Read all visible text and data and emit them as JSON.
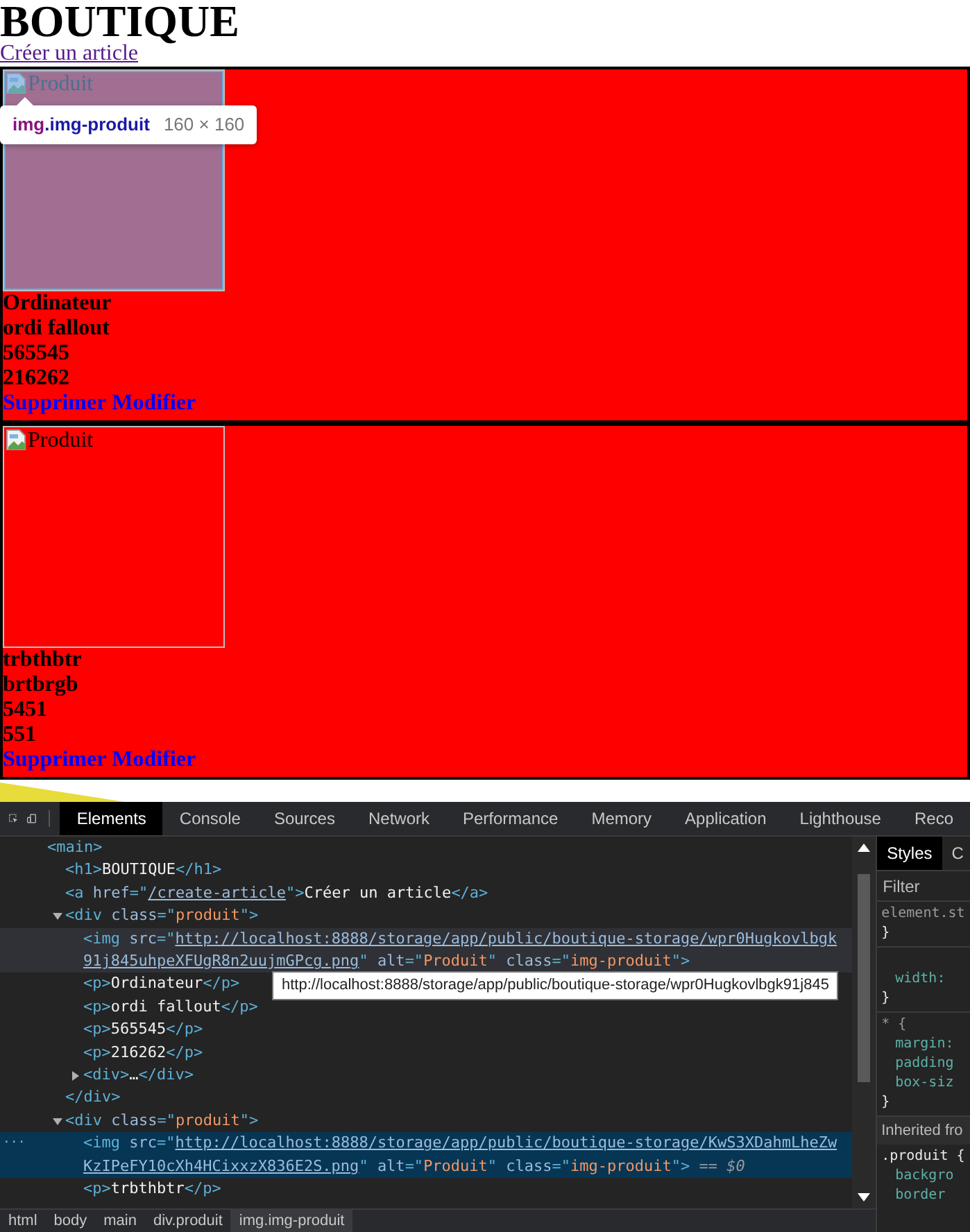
{
  "page": {
    "heading": "BOUTIQUE",
    "link": "Créer un article",
    "products": [
      {
        "image_alt": "Produit",
        "inspected": true,
        "details": [
          "Ordinateur",
          "ordi fallout",
          "565545",
          "216262"
        ],
        "actions": [
          "Supprimer",
          "Modifier"
        ]
      },
      {
        "image_alt": "Produit",
        "inspected": false,
        "details": [
          "trbthbtr",
          "brtbrgb",
          "5451",
          "551"
        ],
        "actions": [
          "Supprimer",
          "Modifier"
        ]
      }
    ]
  },
  "inspect_tooltip": {
    "tag": "img",
    "class": ".img-produit",
    "size": "160 × 160"
  },
  "devtools": {
    "tabs": [
      {
        "label": "Elements",
        "selected": true
      },
      {
        "label": "Console",
        "selected": false
      },
      {
        "label": "Sources",
        "selected": false
      },
      {
        "label": "Network",
        "selected": false
      },
      {
        "label": "Performance",
        "selected": false
      },
      {
        "label": "Memory",
        "selected": false
      },
      {
        "label": "Application",
        "selected": false
      },
      {
        "label": "Lighthouse",
        "selected": false
      },
      {
        "label": "Reco",
        "selected": false
      }
    ],
    "tree": [
      {
        "parts": [
          {
            "kind": "tag",
            "text": "<main>"
          }
        ],
        "children": [
          {
            "parts": [
              {
                "kind": "tag",
                "text": "<h1>"
              },
              {
                "kind": "text",
                "text": "BOUTIQUE"
              },
              {
                "kind": "tag",
                "text": "</h1>"
              }
            ]
          },
          {
            "parts": [
              {
                "kind": "tag",
                "text": "<a "
              },
              {
                "kind": "attr",
                "text": "href"
              },
              {
                "kind": "tag",
                "text": "=\""
              },
              {
                "kind": "link",
                "text": "/create-article"
              },
              {
                "kind": "tag",
                "text": "\">"
              },
              {
                "kind": "text",
                "text": "Créer un article"
              },
              {
                "kind": "tag",
                "text": "</a>"
              }
            ]
          },
          {
            "parts": [
              {
                "kind": "tag",
                "text": "<div "
              },
              {
                "kind": "attr",
                "text": "class"
              },
              {
                "kind": "tag",
                "text": "=\""
              },
              {
                "kind": "value",
                "text": "produit"
              },
              {
                "kind": "tag",
                "text": "\">"
              }
            ],
            "expanded": true,
            "closing": "</div>",
            "children": [
              {
                "hovered": true,
                "selected": false,
                "parts": [
                  {
                    "kind": "tag",
                    "text": "<img "
                  },
                  {
                    "kind": "attr",
                    "text": "src"
                  },
                  {
                    "kind": "tag",
                    "text": "=\""
                  },
                  {
                    "kind": "link",
                    "text": "http://localhost:8888/storage/app/public/boutique-storage/wpr0Hugkovlbgk91j845uhpeXFUgR8n2uujmGPcg.png"
                  },
                  {
                    "kind": "tag",
                    "text": "\" "
                  },
                  {
                    "kind": "attr",
                    "text": "alt"
                  },
                  {
                    "kind": "tag",
                    "text": "=\""
                  },
                  {
                    "kind": "value",
                    "text": "Produit"
                  },
                  {
                    "kind": "tag",
                    "text": "\" "
                  },
                  {
                    "kind": "attr",
                    "text": "class"
                  },
                  {
                    "kind": "tag",
                    "text": "=\""
                  },
                  {
                    "kind": "value",
                    "text": "img-produit"
                  },
                  {
                    "kind": "tag",
                    "text": "\">"
                  }
                ]
              },
              {
                "parts": [
                  {
                    "kind": "tag",
                    "text": "<p>"
                  },
                  {
                    "kind": "text",
                    "text": "Ordinateur"
                  },
                  {
                    "kind": "tag",
                    "text": "</p>"
                  }
                ]
              },
              {
                "parts": [
                  {
                    "kind": "tag",
                    "text": "<p>"
                  },
                  {
                    "kind": "text",
                    "text": "ordi fallout"
                  },
                  {
                    "kind": "tag",
                    "text": "</p>"
                  }
                ]
              },
              {
                "parts": [
                  {
                    "kind": "tag",
                    "text": "<p>"
                  },
                  {
                    "kind": "text",
                    "text": "565545"
                  },
                  {
                    "kind": "tag",
                    "text": "</p>"
                  }
                ]
              },
              {
                "parts": [
                  {
                    "kind": "tag",
                    "text": "<p>"
                  },
                  {
                    "kind": "text",
                    "text": "216262"
                  },
                  {
                    "kind": "tag",
                    "text": "</p>"
                  }
                ]
              },
              {
                "parts": [
                  {
                    "kind": "tag",
                    "text": "<div>"
                  },
                  {
                    "kind": "text",
                    "text": "…"
                  },
                  {
                    "kind": "tag",
                    "text": "</div>"
                  }
                ],
                "expanded": false
              }
            ]
          },
          {
            "parts": [
              {
                "kind": "tag",
                "text": "<div "
              },
              {
                "kind": "attr",
                "text": "class"
              },
              {
                "kind": "tag",
                "text": "=\""
              },
              {
                "kind": "value",
                "text": "produit"
              },
              {
                "kind": "tag",
                "text": "\">"
              }
            ],
            "expanded": true,
            "children": [
              {
                "hovered": false,
                "selected": true,
                "gutter": "···",
                "parts": [
                  {
                    "kind": "tag",
                    "text": "<img "
                  },
                  {
                    "kind": "attr",
                    "text": "src"
                  },
                  {
                    "kind": "tag",
                    "text": "=\""
                  },
                  {
                    "kind": "link",
                    "text": "http://localhost:8888/storage/app/public/boutique-storage/KwS3XDahmLheZwKzIPeFY10cXh4HCixxzX836E2S.png"
                  },
                  {
                    "kind": "tag",
                    "text": "\" "
                  },
                  {
                    "kind": "attr",
                    "text": "alt"
                  },
                  {
                    "kind": "tag",
                    "text": "=\""
                  },
                  {
                    "kind": "value",
                    "text": "Produit"
                  },
                  {
                    "kind": "tag",
                    "text": "\" "
                  },
                  {
                    "kind": "attr",
                    "text": "class"
                  },
                  {
                    "kind": "tag",
                    "text": "=\""
                  },
                  {
                    "kind": "value",
                    "text": "img-produit"
                  },
                  {
                    "kind": "tag",
                    "text": "\">"
                  },
                  {
                    "kind": "marker",
                    "text": " == $0"
                  }
                ]
              },
              {
                "parts": [
                  {
                    "kind": "tag",
                    "text": "<p>"
                  },
                  {
                    "kind": "text",
                    "text": "trbthbtr"
                  },
                  {
                    "kind": "tag",
                    "text": "</p>"
                  }
                ]
              }
            ]
          }
        ]
      }
    ],
    "url_tooltip": "http://localhost:8888/storage/app/public/boutique-storage/wpr0Hugkovlbgk91j845",
    "breadcrumbs": [
      {
        "label": "html",
        "selected": false
      },
      {
        "label": "body",
        "selected": false
      },
      {
        "label": "main",
        "selected": false
      },
      {
        "label": "div.produit",
        "selected": false
      },
      {
        "label": "img.img-produit",
        "selected": true
      }
    ],
    "styles": {
      "tabs": [
        {
          "label": "Styles",
          "selected": true
        },
        {
          "label": "C",
          "selected": false
        }
      ],
      "filter_placeholder": "Filter",
      "rules": [
        {
          "selector": "element.st",
          "close": "}"
        },
        {
          "properties": [
            "width:"
          ],
          "close": "}"
        },
        {
          "selector": "* {",
          "properties": [
            "margin:",
            "padding",
            "box-siz"
          ],
          "close": "}"
        }
      ],
      "inherited_header": "Inherited fro",
      "inherited_rules": [
        {
          "selector": ".produit {",
          "properties": [
            "backgro",
            "border"
          ]
        }
      ]
    }
  }
}
